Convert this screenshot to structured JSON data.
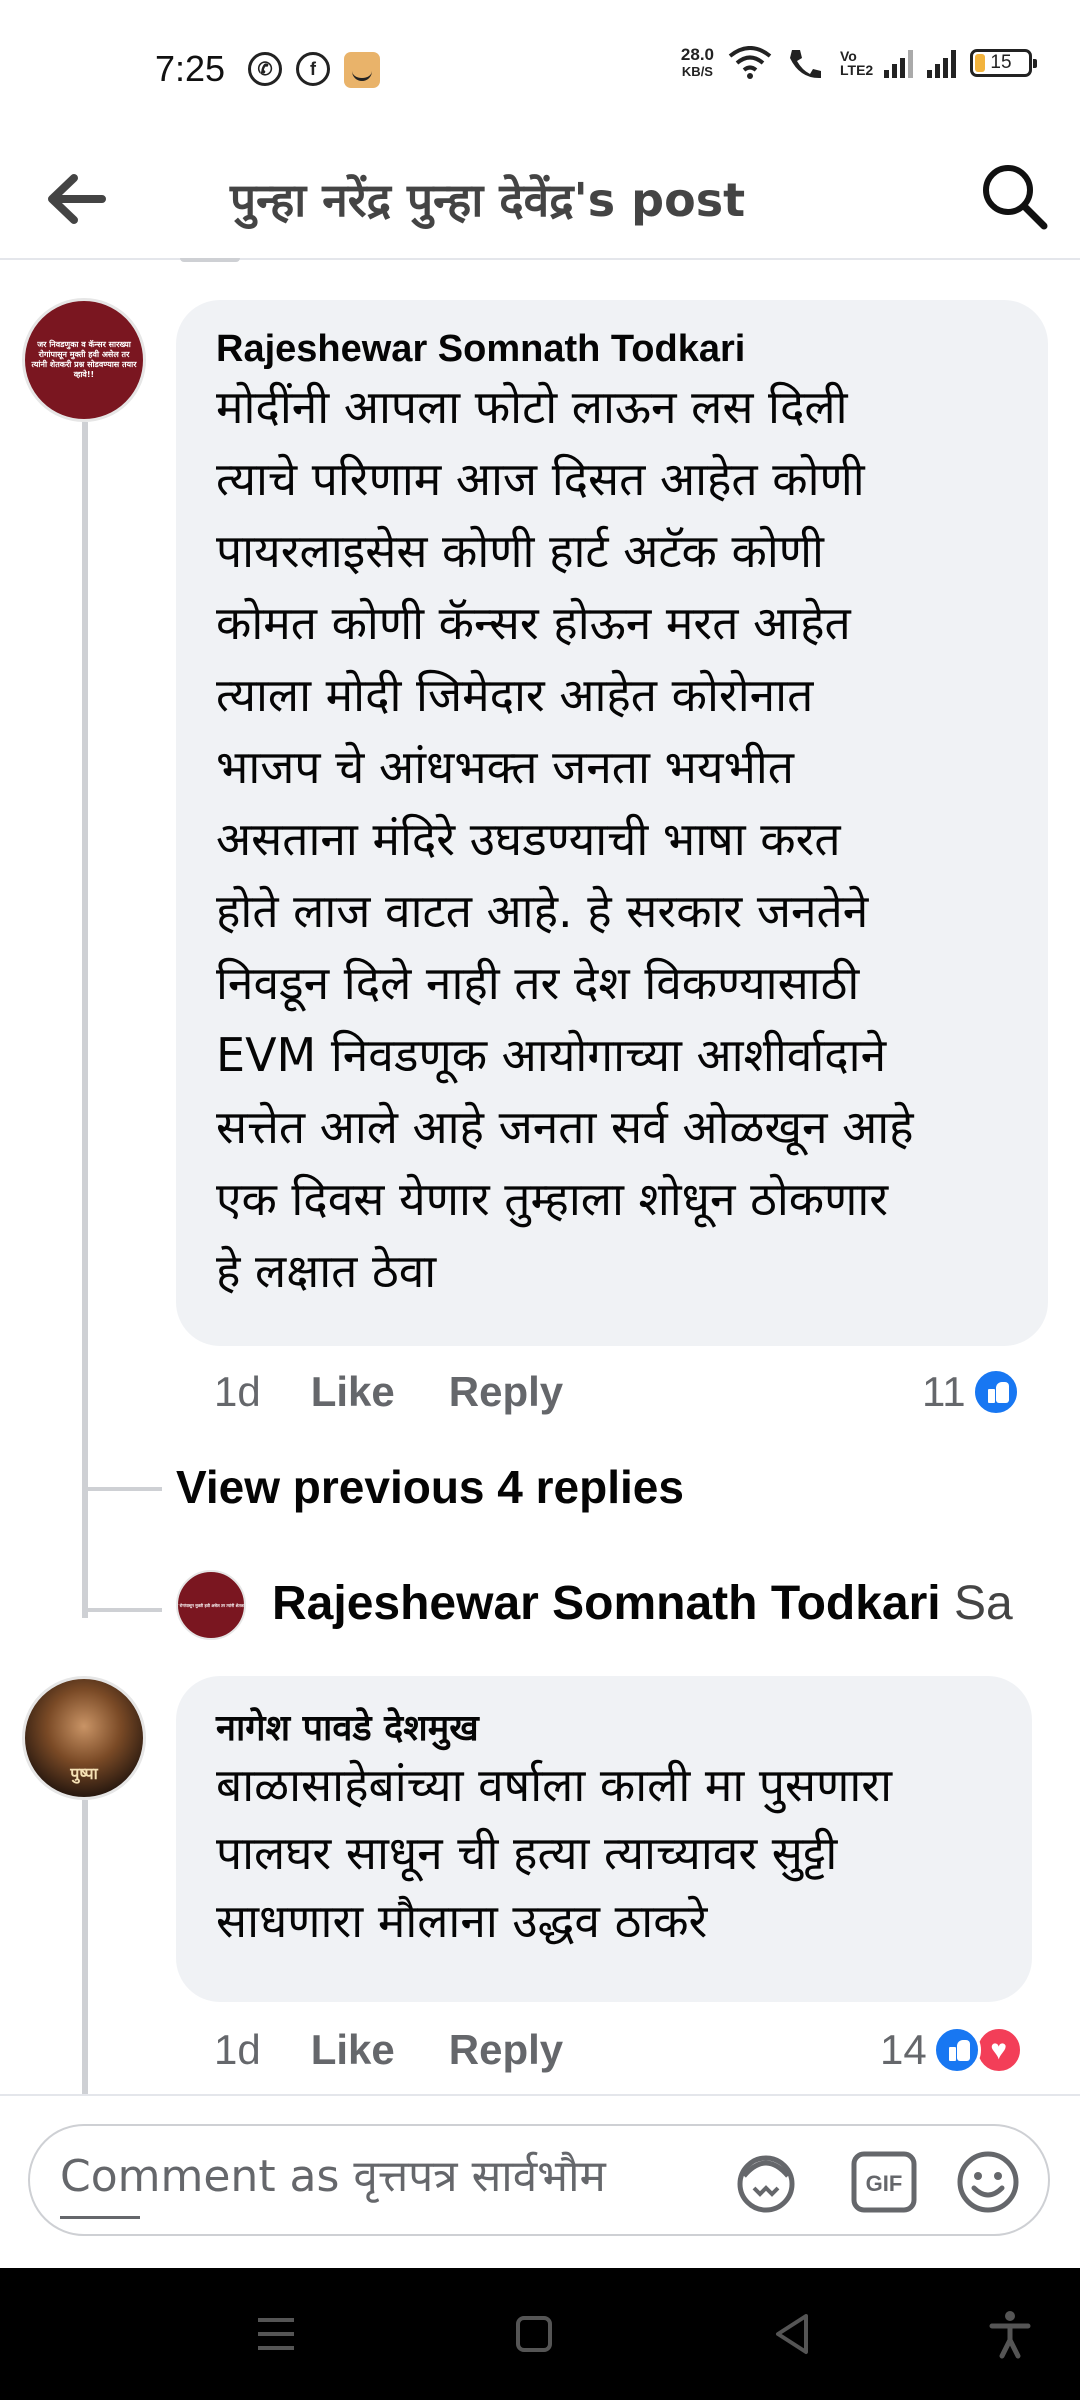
{
  "status_bar": {
    "time": "7:25",
    "data_speed_value": "28.0",
    "data_speed_unit": "KB/S",
    "lte_label": "Vo LTE2",
    "battery": "15"
  },
  "header": {
    "title": "पुन्हा नरेंद्र पुन्हा देवेंद्र's post"
  },
  "comments": [
    {
      "author": "Rajeshewar Somnath Todkari",
      "avatar_text": "जर निवडणुका व कॅन्सर सारख्या रोगांपासून मुक्ती हवी असेल तर त्यांनी शेतकरी प्रश्न सोडवण्यास तयार व्हावे!!",
      "text": "मोदींनी आपला फोटो लाऊन लस दिली\nत्याचे परिणाम आज दिसत आहेत कोणी\nपायरलाइसेस  कोणी हार्ट अटॅक कोणी\nकोमत कोणी कॅन्सर होऊन मरत आहेत\nत्याला मोदी जिमेदार आहेत कोरोनात\nभाजप चे आंधभक्त जनता भयभीत\nअसताना मंदिरे उघडण्याची भाषा करत\nहोते लाज वाटत आहे. हे सरकार जनतेने\nनिवडून दिले नाही तर देश विकण्यासाठी\nEVM निवडणूक आयोगाच्या आशीर्वादाने\nसत्तेत आले आहे जनता सर्व ओळखून आहे\nएक दिवस येणार तुम्हाला शोधून ठोकणार\nहे लक्षात ठेवा",
      "time": "1d",
      "like_label": "Like",
      "reply_label": "Reply",
      "reaction_count": "11"
    },
    {
      "author": "नागेश पावडे देशमुख",
      "avatar_text": "पुष्पा",
      "text": "बाळासाहेबांच्या वर्षाला काली मा पुसणारा\nपालघर साधून ची हत्या त्याच्यावर सुट्टी\nसाधणारा मौलाना उद्धव ठाकरे",
      "time": "1d",
      "like_label": "Like",
      "reply_label": "Reply",
      "reaction_count": "14"
    }
  ],
  "thread": {
    "view_previous_label": "View previous 4 replies",
    "reply_preview_author": "Rajeshewar Somnath Todkari",
    "reply_preview_snippet": "Sa"
  },
  "composer": {
    "placeholder": "Comment as वृत्तपत्र सार्वभौम"
  },
  "icons": {
    "back": "arrow-left-icon",
    "search": "search-icon",
    "avatar_sticker": "sticker-icon",
    "gif": "gif-icon",
    "emoji": "emoji-icon"
  },
  "colors": {
    "accent": "#1877f2",
    "love": "#f33e58",
    "bubble": "#f0f2f5"
  }
}
